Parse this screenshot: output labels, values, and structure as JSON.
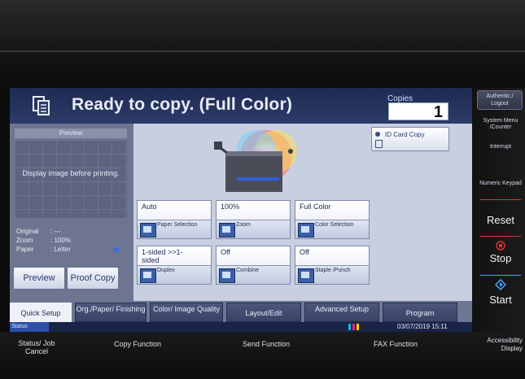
{
  "screen": {
    "title": "Ready to copy. (Full Color)",
    "copies_label": "Copies",
    "copies_value": "1"
  },
  "preview": {
    "header": "Preview",
    "message": "Display image before printing.",
    "info": [
      {
        "key": "Original",
        "value": ": ---"
      },
      {
        "key": "Zoom",
        "value": ": 100%"
      },
      {
        "key": "Paper",
        "value": ": Letter"
      }
    ],
    "preview_button": "Preview",
    "proof_copy_button": "Proof Copy"
  },
  "id_card_copy": "ID Card Copy",
  "functions": [
    {
      "value": "Auto",
      "label": "Paper Selection"
    },
    {
      "value": "100%",
      "label": "Zoom"
    },
    {
      "value": "Full Color",
      "label": "Color Selection"
    },
    {
      "value": "1-sided >>1-sided",
      "label": "Duplex"
    },
    {
      "value": "Off",
      "label": "Combine"
    },
    {
      "value": "Off",
      "label": "Staple /Punch"
    }
  ],
  "tabs": [
    "Quick Setup",
    "Org./Paper/ Finishing",
    "Color/ Image Quality",
    "Layout/Edit",
    "Advanced Setup",
    "Program"
  ],
  "status": {
    "label": "Status",
    "datetime": "03/07/2019  15:11"
  },
  "side": {
    "authentic": "Authentic./ Logout",
    "system_menu": "System Menu /Counter",
    "interrupt": "Interrupt",
    "numeric_keypad": "Numeric Keypad",
    "reset": "Reset",
    "stop": "Stop",
    "start": "Start"
  },
  "bottom": {
    "status_job_cancel": "Status/ Job Cancel",
    "copy_function": "Copy Function",
    "send_function": "Send Function",
    "fax_function": "FAX Function",
    "accessibility": "Accessibility Display"
  },
  "colors": {
    "title_bar": "#1e2b52",
    "reset_line": "#d33",
    "stop_line": "#d33",
    "start_line": "#4aa3ff"
  }
}
